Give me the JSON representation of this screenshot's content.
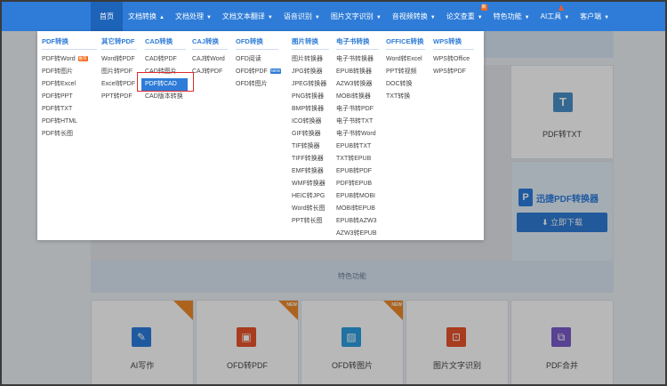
{
  "nav": {
    "items": [
      {
        "label": "首页",
        "arrow": ""
      },
      {
        "label": "文档转换",
        "arrow": "▲"
      },
      {
        "label": "文档处理",
        "arrow": "▼"
      },
      {
        "label": "文档文本翻译",
        "arrow": "▼"
      },
      {
        "label": "语音识别",
        "arrow": "▼"
      },
      {
        "label": "图片文字识别",
        "arrow": "▼"
      },
      {
        "label": "音视频转换",
        "arrow": "▼"
      },
      {
        "label": "论文查重",
        "arrow": "▼"
      },
      {
        "label": "特色功能",
        "arrow": "▼"
      },
      {
        "label": "AI工具",
        "arrow": "▼"
      },
      {
        "label": "客户端",
        "arrow": "▼"
      }
    ],
    "new_badge": "新"
  },
  "dropdown": {
    "columns": [
      {
        "head": "PDF转换",
        "items": [
          "PDF转Word",
          "PDF转图片",
          "PDF转Excel",
          "PDF转PPT",
          "PDF转TXT",
          "PDF转HTML",
          "PDF转长图"
        ]
      },
      {
        "head": "其它转PDF",
        "items": [
          "Word转PDF",
          "图片转PDF",
          "Excel转PDF",
          "PPT转PDF"
        ]
      },
      {
        "head": "CAD转换",
        "items": [
          "CAD转PDF",
          "CAD转图片",
          "PDF转CAD",
          "CAD版本转换"
        ]
      },
      {
        "head": "CAJ转换",
        "items": [
          "CAJ转Word",
          "CAJ转PDF"
        ]
      },
      {
        "head": "OFD转换",
        "items": [
          "OFD阅读",
          "OFD转PDF",
          "OFD转图片"
        ]
      },
      {
        "head": "图片转换",
        "items": [
          "图片转换器",
          "JPG转换器",
          "JPEG转换器",
          "PNG转换器",
          "BMP转换器",
          "ICO转换器",
          "GIF转换器",
          "TIF转换器",
          "TIFF转换器",
          "EMF转换器",
          "WMF转换器",
          "HEIC转JPG",
          "Word转长图",
          "PPT转长图"
        ]
      },
      {
        "head": "电子书转换",
        "items": [
          "电子书转换器",
          "EPUB转换器",
          "AZW3转换器",
          "MOBI转换器",
          "电子书转PDF",
          "电子书转TXT",
          "电子书转Word",
          "EPUB转TXT",
          "TXT转EPUB",
          "EPUB转PDF",
          "PDF转EPUB",
          "EPUB转MOBI",
          "MOBI转EPUB",
          "EPUB转AZW3",
          "AZW3转EPUB"
        ]
      },
      {
        "head": "OFFICE转换",
        "items": [
          "Word转Excel",
          "PPT转视频",
          "DOC转换",
          "TXT转换"
        ]
      },
      {
        "head": "WPS转换",
        "items": [
          "WPS转Office",
          "WPS转PDF"
        ]
      }
    ],
    "hot_tag": "推荐",
    "new_tag": "NEW"
  },
  "page": {
    "pdf_txt_label": "PDF转TXT",
    "promo_title": "迅捷PDF转换器",
    "download_label": "立即下载",
    "features_title": "特色功能",
    "features": [
      {
        "label": "AI写作",
        "icon": "pen-icon",
        "color": "#2b7de0",
        "badge": ""
      },
      {
        "label": "OFD转PDF",
        "icon": "image-icon",
        "color": "#e8542c",
        "badge": "NEW"
      },
      {
        "label": "OFD转图片",
        "icon": "picture-icon",
        "color": "#2b9fe0",
        "badge": "NEW"
      },
      {
        "label": "图片文字识别",
        "icon": "scan-icon",
        "color": "#e8542c",
        "badge": ""
      },
      {
        "label": "PDF合并",
        "icon": "merge-icon",
        "color": "#7a5cc9",
        "badge": ""
      }
    ]
  },
  "colors": {
    "nav_bg": "#2e7cd7",
    "accent": "#2e7cd7",
    "highlight_border": "#e02a2a"
  }
}
